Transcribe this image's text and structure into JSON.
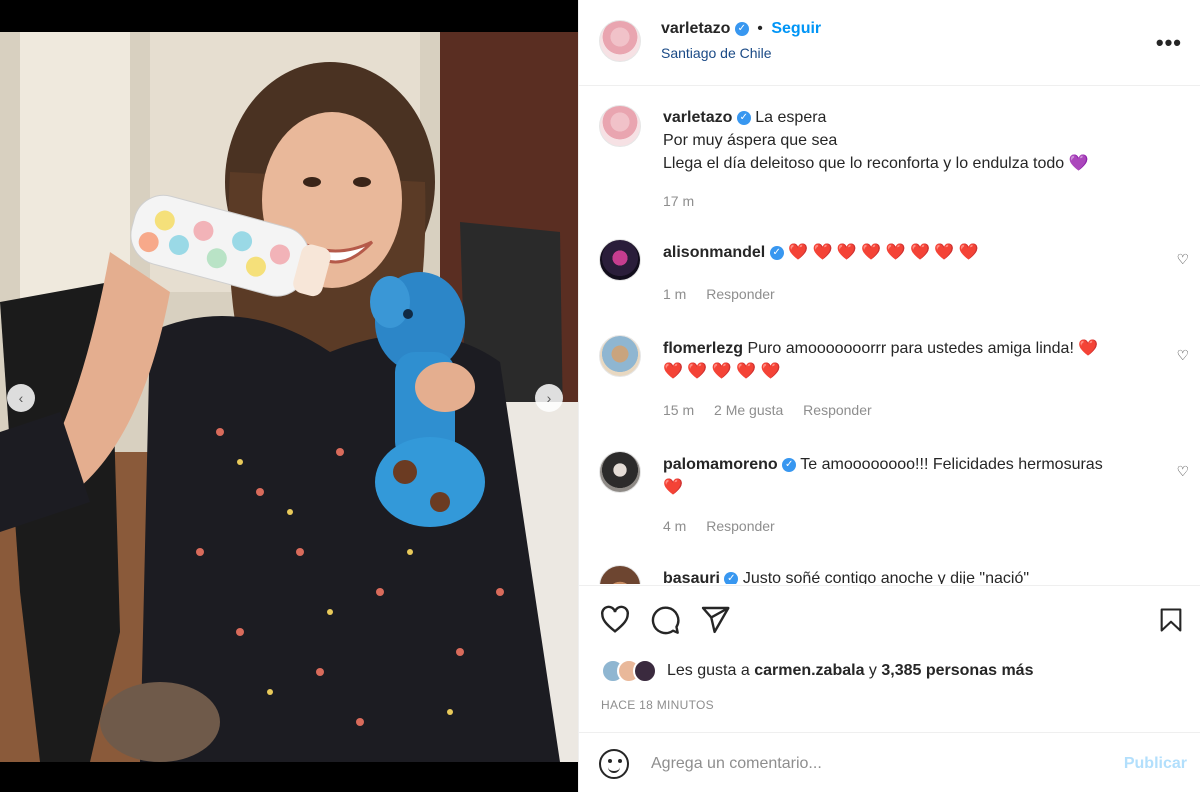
{
  "post": {
    "author": "varletazo",
    "follow_label": "Seguir",
    "separator": "•",
    "location": "Santiago de Chile",
    "more_label": "•••"
  },
  "caption": {
    "username": "varletazo",
    "line1": "La espera",
    "line2": "Por muy áspera que sea",
    "line3": "Llega el día deleitoso que lo reconforta y lo endulza todo",
    "emoji": "💜",
    "time": "17 m"
  },
  "comments": [
    {
      "username": "alisonmandel",
      "verified": true,
      "text": "",
      "hearts": "❤️ ❤️ ❤️ ❤️ ❤️ ❤️ ❤️ ❤️",
      "time": "1 m",
      "likes": "",
      "reply_label": "Responder"
    },
    {
      "username": "flomerlezg",
      "verified": false,
      "text": "Puro amooooooorrr para ustedes amiga linda!",
      "hearts": "❤️",
      "hearts_line2": "❤️ ❤️ ❤️ ❤️ ❤️",
      "time": "15 m",
      "likes": "2 Me gusta",
      "reply_label": "Responder"
    },
    {
      "username": "palomamoreno",
      "verified": true,
      "text": "Te amoooooooo!!! Felicidades hermosuras",
      "hearts_line2": "❤️",
      "time": "4 m",
      "likes": "",
      "reply_label": "Responder"
    },
    {
      "username": "basauri",
      "verified": true,
      "text": "Justo soñé contigo anoche y dije \"nació\"",
      "time": "",
      "reply_label": ""
    }
  ],
  "likes": {
    "prefix": "Les gusta a",
    "user": "carmen.zabala",
    "connector": "y",
    "count": "3,385 personas más"
  },
  "posted_time": "HACE 18 MINUTOS",
  "comment_input": {
    "placeholder": "Agrega un comentario...",
    "publish_label": "Publicar"
  },
  "icons": {
    "heart": "heart-icon",
    "comment": "comment-icon",
    "share": "share-icon",
    "save": "bookmark-icon",
    "emoji": "emoji-icon",
    "prev": "chevron-left-icon",
    "next": "chevron-right-icon"
  },
  "colors": {
    "accent": "#0095f6",
    "verified": "#3897f0",
    "heart": "#ed4956",
    "location": "#1a4a86"
  }
}
